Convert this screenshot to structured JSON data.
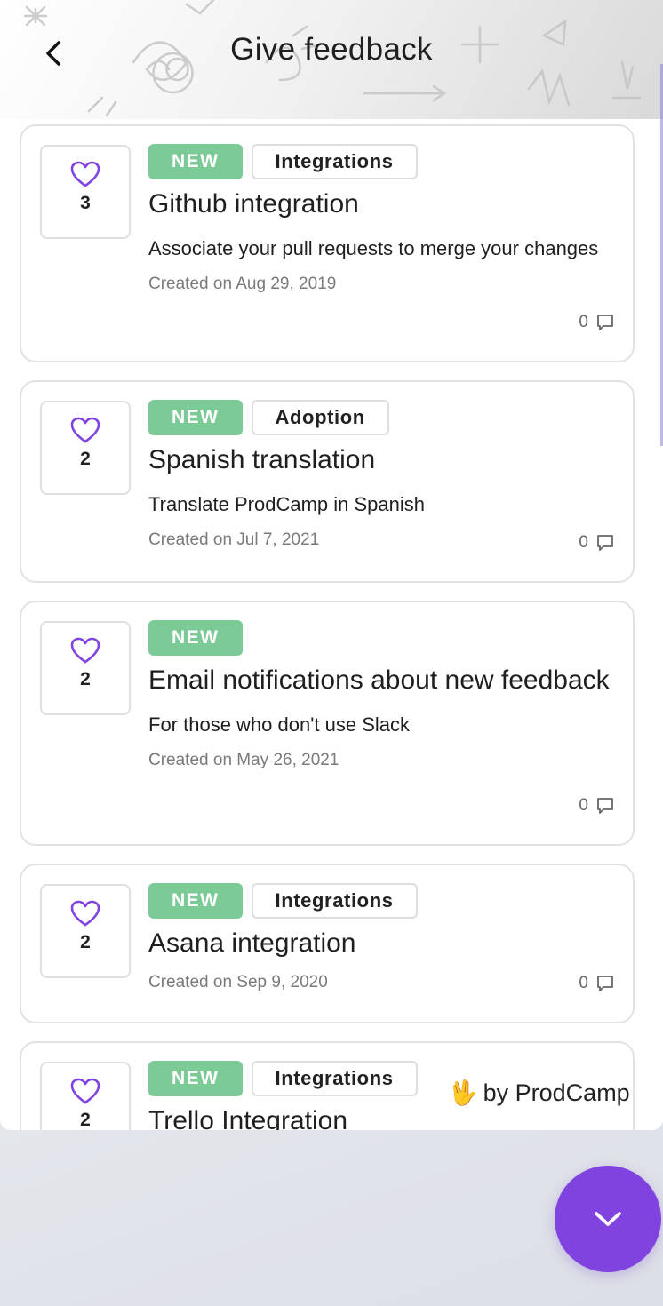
{
  "header": {
    "title": "Give feedback"
  },
  "cards": [
    {
      "votes": "3",
      "new_label": "NEW",
      "category": "Integrations",
      "title": "Github integration",
      "description": "Associate your pull requests to merge your changes",
      "date": "Created on Aug 29, 2019",
      "comments": "0"
    },
    {
      "votes": "2",
      "new_label": "NEW",
      "category": "Adoption",
      "title": "Spanish translation",
      "description": "Translate ProdCamp in Spanish",
      "date": "Created on Jul 7, 2021",
      "comments": "0"
    },
    {
      "votes": "2",
      "new_label": "NEW",
      "category": "",
      "title": "Email notifications about new feedback",
      "description": "For those who don't use Slack",
      "date": "Created on May 26, 2021",
      "comments": "0"
    },
    {
      "votes": "2",
      "new_label": "NEW",
      "category": "Integrations",
      "title": "Asana integration",
      "description": "",
      "date": "Created on Sep 9, 2020",
      "comments": "0"
    },
    {
      "votes": "2",
      "new_label": "NEW",
      "category": "Integrations",
      "title": "Trello Integration",
      "description": "",
      "date": "",
      "comments": ""
    }
  ],
  "branding": {
    "emoji": "🖖",
    "text": "by ProdCamp"
  },
  "colors": {
    "accent": "#8143e0",
    "new_tag": "#7ccb97",
    "heart": "#8143e0"
  },
  "icons": {
    "back": "chevron-left-icon",
    "vote": "heart-icon",
    "comment": "comment-icon",
    "fab": "chevron-down-icon"
  }
}
